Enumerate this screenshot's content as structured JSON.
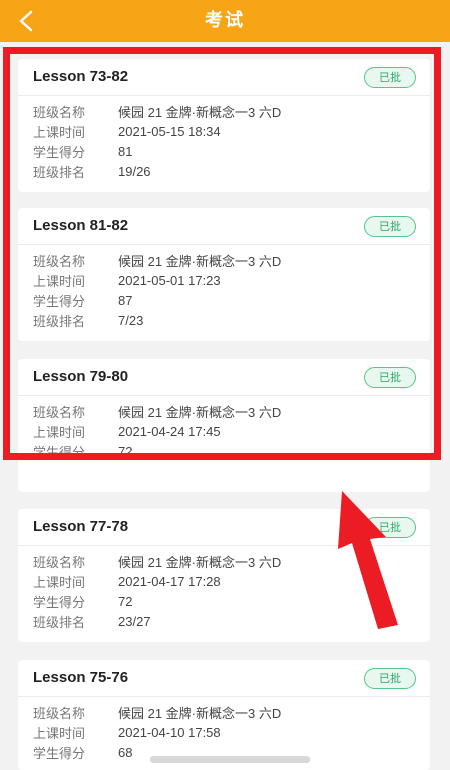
{
  "header": {
    "title": "考试",
    "back_icon": "chevron-left-icon"
  },
  "colors": {
    "header": "#f7a514",
    "badge": "#2fa866",
    "highlight": "#ec1c24"
  },
  "labels": {
    "class_name": "班级名称",
    "class_time": "上课时间",
    "student_score": "学生得分",
    "class_rank": "班级排名"
  },
  "exams": [
    {
      "lesson": "Lesson 73-82",
      "status": "已批",
      "class_name": "候园 21 金牌·新概念一3 六D",
      "class_time": "2021-05-15 18:34",
      "score": "81",
      "rank": "19/26"
    },
    {
      "lesson": "Lesson 81-82",
      "status": "已批",
      "class_name": "候园 21 金牌·新概念一3 六D",
      "class_time": "2021-05-01 17:23",
      "score": "87",
      "rank": "7/23"
    },
    {
      "lesson": "Lesson 79-80",
      "status": "已批",
      "class_name": "候园 21 金牌·新概念一3 六D",
      "class_time": "2021-04-24 17:45",
      "score": "72"
    },
    {
      "lesson": "Lesson 77-78",
      "status": "已批",
      "class_name": "候园 21 金牌·新概念一3 六D",
      "class_time": "2021-04-17 17:28",
      "score": "72",
      "rank": "23/27"
    },
    {
      "lesson": "Lesson 75-76",
      "status": "已批",
      "class_name": "候园 21 金牌·新概念一3 六D",
      "class_time": "2021-04-10 17:58",
      "score": "68"
    }
  ]
}
